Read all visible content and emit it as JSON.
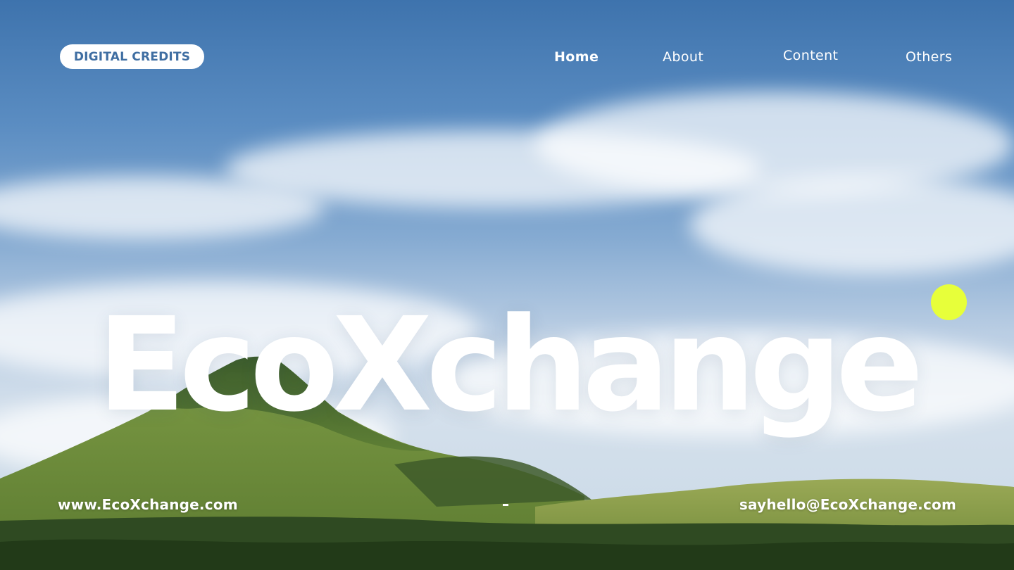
{
  "header": {
    "brand_label": "DIGITAL CREDITS",
    "nav": [
      {
        "label": "Home",
        "active": true
      },
      {
        "label": "About",
        "active": false
      },
      {
        "label": "Content",
        "active": false
      },
      {
        "label": "Others",
        "active": false
      }
    ]
  },
  "hero": {
    "title": "EcoXchange",
    "accent_color": "#e7ff3a"
  },
  "footer": {
    "website": "www.EcoXchange.com",
    "email": "sayhello@EcoXchange.com"
  },
  "colors": {
    "brand_text": "#3f6ea2",
    "sky": "#4f82b8",
    "text": "#ffffff"
  }
}
